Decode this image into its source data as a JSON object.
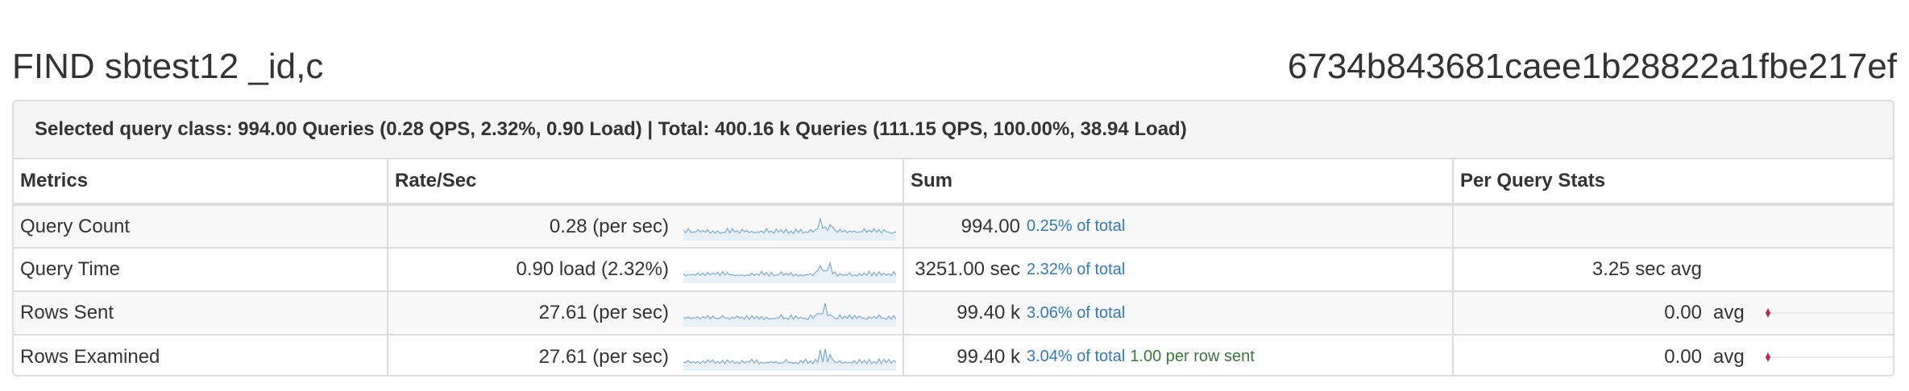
{
  "heading": {
    "title": "FIND sbtest12 _id,c",
    "checksum": "6734b843681caee1b28822a1fbe217ef"
  },
  "summary": "Selected query class: 994.00 Queries (0.28 QPS, 2.32%, 0.90 Load) | Total: 400.16 k Queries (111.15 QPS, 100.00%, 38.94 Load)",
  "table": {
    "headers": [
      "Metrics",
      "Rate/Sec",
      "Sum",
      "Per Query Stats"
    ],
    "rows": [
      {
        "metric": "Query Count",
        "rate": "0.28 (per sec)",
        "sum": "994.00",
        "pct_of_total": "0.25% of total",
        "per_row": "",
        "pq_value": "",
        "pq_label": ""
      },
      {
        "metric": "Query Time",
        "rate": "0.90 load (2.32%)",
        "sum": "3251.00 sec",
        "pct_of_total": "2.32% of total",
        "per_row": "",
        "pq_value": "3.25 sec avg",
        "pq_label": ""
      },
      {
        "metric": "Rows Sent",
        "rate": "27.61 (per sec)",
        "sum": "99.40 k",
        "pct_of_total": "3.06% of total",
        "per_row": "",
        "pq_value": "0.00",
        "pq_label": "avg"
      },
      {
        "metric": "Rows Examined",
        "rate": "27.61 (per sec)",
        "sum": "99.40 k",
        "pct_of_total": "3.04% of total",
        "per_row": "1.00 per row sent",
        "pq_value": "0.00",
        "pq_label": "avg"
      }
    ]
  },
  "colors": {
    "link_blue": "#337ab7",
    "success_green": "#3c763d",
    "sparkline": "#7faad1",
    "marker": "#c0254d"
  },
  "icons": {
    "sparkline": "sparkline-chart-icon",
    "range_marker": "diamond-marker-icon"
  }
}
